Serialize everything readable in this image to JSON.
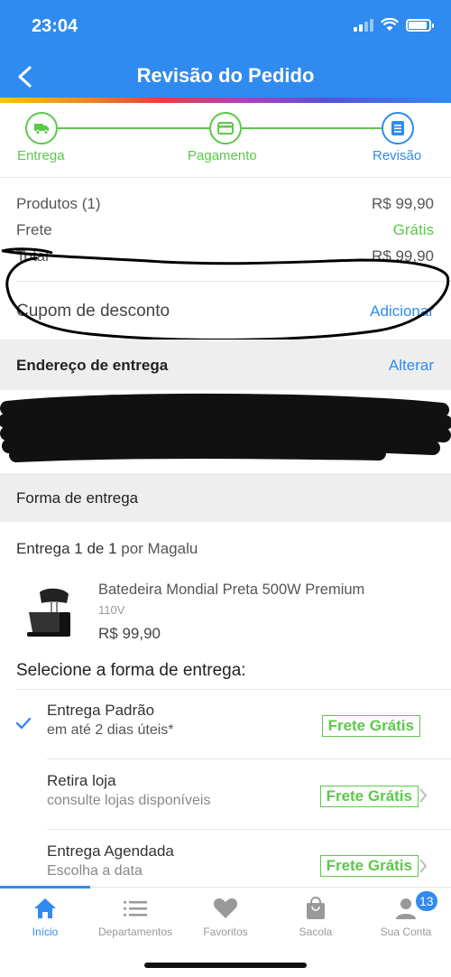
{
  "status_bar": {
    "time": "23:04"
  },
  "header": {
    "title": "Revisão do Pedido"
  },
  "steps": [
    {
      "label": "Entrega",
      "icon": "truck-icon"
    },
    {
      "label": "Pagamento",
      "icon": "card-icon"
    },
    {
      "label": "Revisão",
      "icon": "document-icon"
    }
  ],
  "summary": {
    "products_label": "Produtos (1)",
    "products_value": "R$ 99,90",
    "freight_label": "Frete",
    "freight_value": "Grátis",
    "total_label": "Total",
    "total_value": "R$ 99,90"
  },
  "coupon": {
    "label": "Cupom de desconto",
    "action": "Adicionar"
  },
  "address": {
    "title": "Endereço de entrega",
    "action": "Alterar"
  },
  "delivery": {
    "title": "Forma de entrega",
    "shipment_prefix": "Entrega 1 de 1",
    "shipment_suffix": "por Magalu",
    "product": {
      "name": "Batedeira Mondial Preta 500W Premium",
      "variant": "110V",
      "price": "R$ 99,90"
    },
    "select_title": "Selecione a forma de entrega:",
    "options": [
      {
        "title": "Entrega Padrão",
        "subtitle": "em até 2 dias úteis*",
        "badge": "Frete Grátis",
        "selected": true
      },
      {
        "title": "Retira loja",
        "subtitle": "consulte lojas disponíveis",
        "badge": "Frete Grátis",
        "selected": false
      },
      {
        "title": "Entrega Agendada",
        "subtitle": "Escolha a data",
        "badge": "Frete Grátis",
        "selected": false
      }
    ]
  },
  "bottom_nav": {
    "items": [
      {
        "label": "Início",
        "icon": "home-icon",
        "active": true
      },
      {
        "label": "Departamentos",
        "icon": "menu-icon"
      },
      {
        "label": "Favoritos",
        "icon": "heart-icon"
      },
      {
        "label": "Sacola",
        "icon": "bag-icon"
      },
      {
        "label": "Sua Conta",
        "icon": "user-icon"
      }
    ],
    "account_badge": "13"
  },
  "colors": {
    "primary": "#2f8bf0",
    "success": "#5cc84a"
  }
}
